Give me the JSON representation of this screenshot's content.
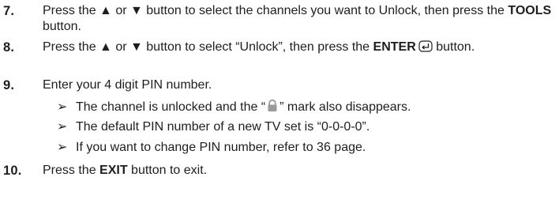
{
  "steps": [
    {
      "number": "7.",
      "parts": [
        "Press the ▲ or ▼ button to select the channels you want to Unlock, then press the ",
        "TOOLS",
        " button."
      ]
    },
    {
      "number": "8.",
      "parts": [
        "Press the ▲ or ▼ button to select “Unlock”, then press the ",
        "ENTER",
        "",
        " button."
      ],
      "icon": "enter-icon"
    },
    {
      "number": "9.",
      "text": "Enter your 4 digit PIN number.",
      "notes": [
        {
          "before": "The channel is unlocked and the “",
          "icon": "lock-icon",
          "after": "” mark also disappears."
        },
        {
          "text": "The default PIN number of a new TV set is “0-0-0-0”."
        },
        {
          "text": "If you want to change PIN number, refer to 36 page."
        }
      ]
    },
    {
      "number": "10.",
      "parts": [
        "Press the ",
        "EXIT",
        " button to exit."
      ]
    }
  ],
  "note_marker": "➢"
}
